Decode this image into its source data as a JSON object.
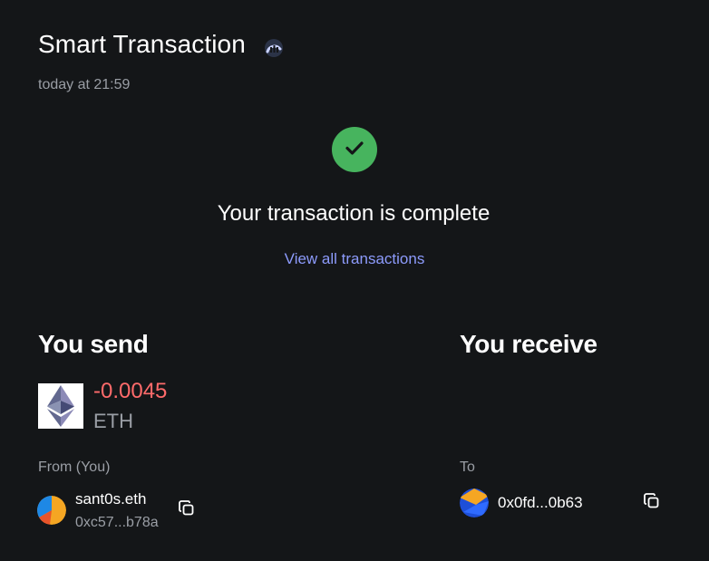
{
  "header": {
    "title": "Smart Transaction",
    "title_icon": "smart-transaction-gauge-icon",
    "timestamp": "today at 21:59"
  },
  "status": {
    "icon": "check-icon",
    "message": "Your transaction is complete",
    "link_label": "View all transactions",
    "colors": {
      "success": "#47b45e",
      "link": "#8d9bfc"
    }
  },
  "send": {
    "heading": "You send",
    "amount": "-0.0045",
    "symbol": "ETH",
    "token_icon": "ethereum-icon",
    "amount_color": "#ff6b6b",
    "from_label": "From (You)",
    "from_name": "sant0s.eth",
    "from_address": "0xc57...b78a",
    "copy_icon": "copy-icon"
  },
  "receive": {
    "heading": "You receive",
    "to_label": "To",
    "to_address": "0x0fd...0b63",
    "copy_icon": "copy-icon"
  }
}
